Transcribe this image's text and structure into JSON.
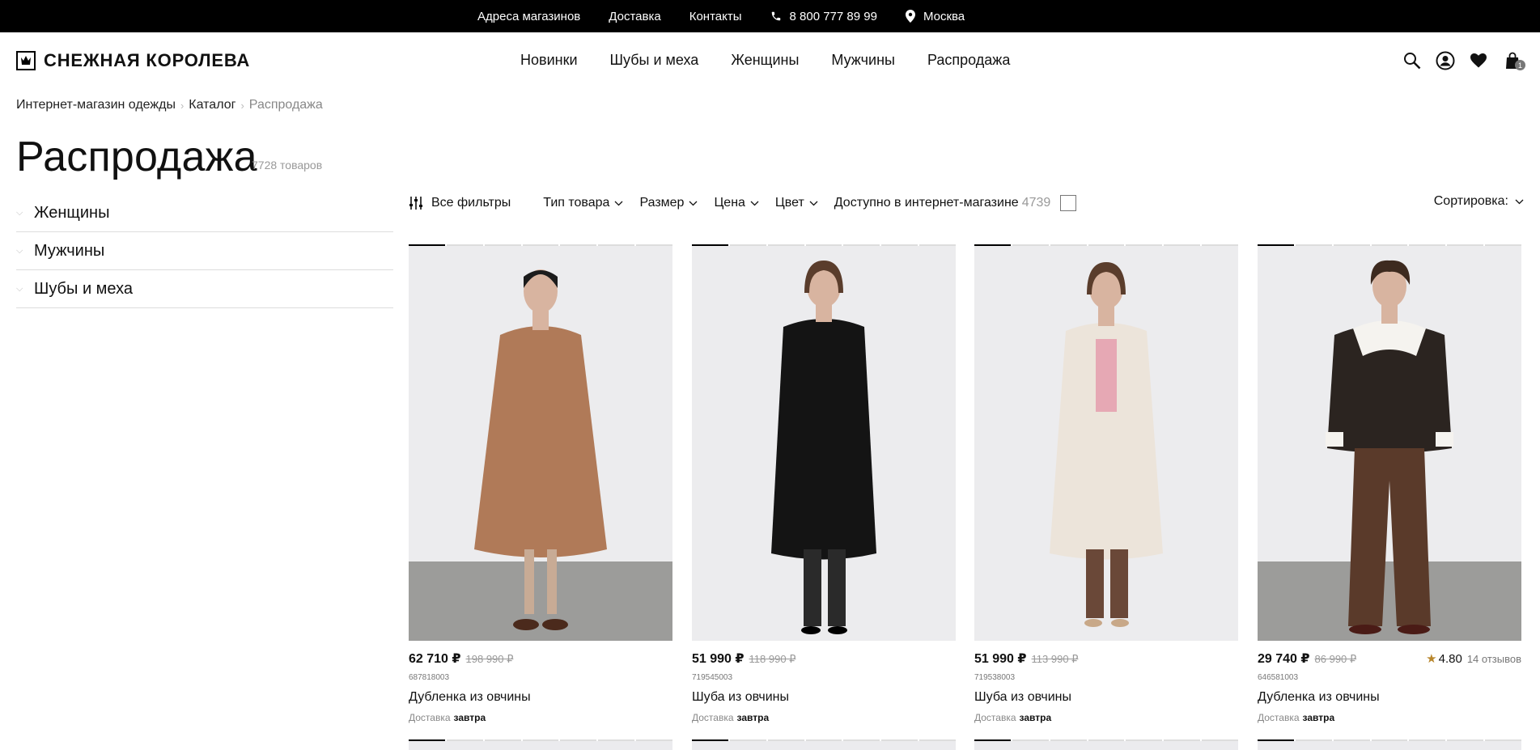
{
  "topbar": {
    "links": [
      "Адреса магазинов",
      "Доставка",
      "Контакты"
    ],
    "phone": "8 800 777 89 99",
    "city": "Москва"
  },
  "header": {
    "logo_text": "СНЕЖНАЯ КОРОЛЕВА",
    "nav": [
      "Новинки",
      "Шубы и меха",
      "Женщины",
      "Мужчины",
      "Распродажа"
    ],
    "cart_count": "1",
    "icons": [
      "search-icon",
      "account-icon",
      "heart-icon",
      "cart-icon"
    ]
  },
  "breadcrumb": [
    "Интернет-магазин одежды",
    "Каталог",
    "Распродажа"
  ],
  "page": {
    "title": "Распродажа",
    "count": "7728 товаров"
  },
  "sidebar": {
    "items": [
      "Женщины",
      "Мужчины",
      "Шубы и меха"
    ]
  },
  "filters": {
    "all": "Все фильтры",
    "type": "Тип товара",
    "size": "Размер",
    "price": "Цена",
    "color": "Цвет",
    "available": "Доступно в интернет-магазине",
    "available_count": "4739",
    "sort": "Сортировка:"
  },
  "products": [
    {
      "price": "62 710 ₽",
      "old_price": "198 990 ₽",
      "sku": "687818003",
      "name": "Дубленка из овчины",
      "delivery_label": "Доставка",
      "delivery_value": "завтра",
      "rating": "",
      "reviews": "",
      "photo_color": "#b07a58",
      "slide_count": 7
    },
    {
      "price": "51 990 ₽",
      "old_price": "118 990 ₽",
      "sku": "719545003",
      "name": "Шуба из овчины",
      "delivery_label": "Доставка",
      "delivery_value": "завтра",
      "rating": "",
      "reviews": "",
      "photo_color": "#111111",
      "slide_count": 7
    },
    {
      "price": "51 990 ₽",
      "old_price": "113 990 ₽",
      "sku": "719538003",
      "name": "Шуба из овчины",
      "delivery_label": "Доставка",
      "delivery_value": "завтра",
      "rating": "",
      "reviews": "",
      "photo_color": "#ece4da",
      "slide_count": 7
    },
    {
      "price": "29 740 ₽",
      "old_price": "86 990 ₽",
      "sku": "646581003",
      "name": "Дубленка из овчины",
      "delivery_label": "Доставка",
      "delivery_value": "завтра",
      "rating": "4.80",
      "reviews": "14 отзывов",
      "photo_color": "#2b2420",
      "slide_count": 7
    }
  ]
}
